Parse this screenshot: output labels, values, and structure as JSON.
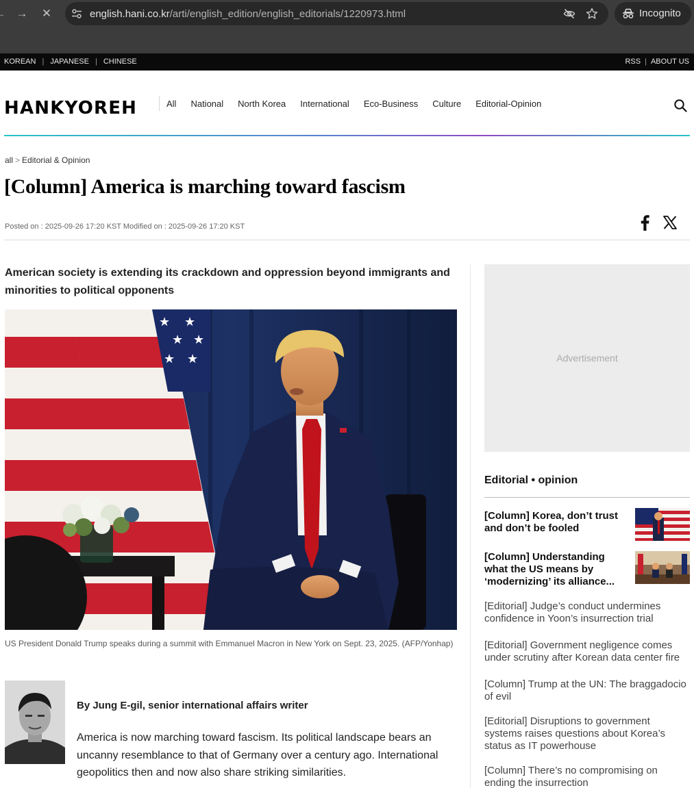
{
  "browser": {
    "url_host": "english.hani.co.kr",
    "url_path": "/arti/english_edition/english_editorials/1220973.html",
    "incognito_label": "Incognito"
  },
  "topbar": {
    "languages": [
      "KOREAN",
      "JAPANESE",
      "CHINESE"
    ],
    "links": [
      "RSS",
      "ABOUT US"
    ]
  },
  "header": {
    "logo": "HANKYOREH",
    "nav": [
      "All",
      "National",
      "North Korea",
      "International",
      "Eco-Business",
      "Culture",
      "Editorial-Opinion"
    ]
  },
  "article": {
    "breadcrumb_root": "all",
    "breadcrumb_sep": ">",
    "breadcrumb_section": "Editorial & Opinion",
    "title": "[Column] America is marching toward fascism",
    "dates": "Posted on : 2025-09-26 17:20 KST Modified on : 2025-09-26 17:20 KST",
    "subhead": "American society is extending its crackdown and oppression beyond immigrants and minorities to political opponents",
    "caption": "US President Donald Trump speaks during a summit with Emmanuel Macron in New York on Sept. 23, 2025. (AFP/Yonhap)",
    "byline": "By Jung E-gil, senior international affairs writer",
    "body": "America is now marching toward fascism. Its political landscape bears an uncanny resemblance to that of Germany over a century ago. International geopolitics then and now also share striking similarities."
  },
  "sidebar": {
    "ad_label": "Advertisement",
    "section_title": "Editorial • opinion",
    "featured": [
      {
        "title": "[Column] Korea, don’t trust and don’t be fooled"
      },
      {
        "title": "[Column] Understanding what the US means by ‘modernizing’ its alliance..."
      }
    ],
    "links": [
      "[Editorial] Judge’s conduct undermines confidence in Yoon’s insurrection trial",
      "[Editorial] Government negligence comes under scrutiny after Korean data center fire",
      "[Column] Trump at the UN: The braggadocio of evil",
      "[Editorial] Disruptions to government systems raises questions about Korea’s status as IT powerhouse",
      "[Column] There’s no compromising on ending the insurrection"
    ]
  }
}
